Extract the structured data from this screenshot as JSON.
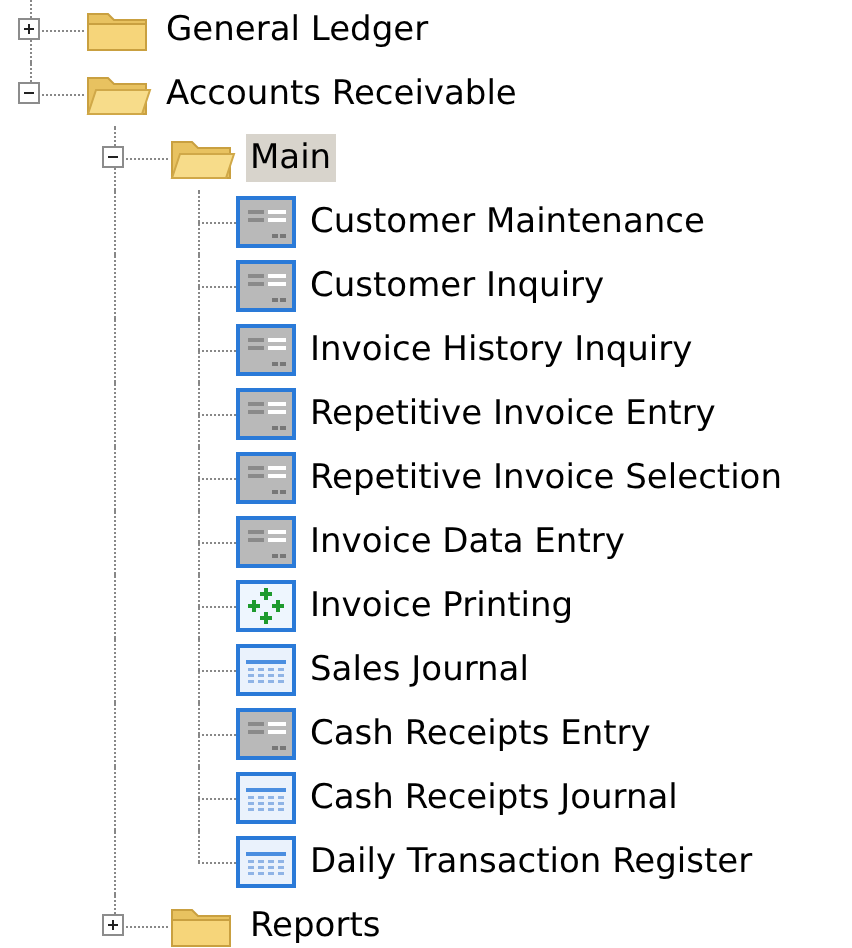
{
  "tree": [
    {
      "label": "General Ledger",
      "kind": "folder",
      "expanded": false,
      "selected": false
    },
    {
      "label": "Accounts Receivable",
      "kind": "folder",
      "expanded": true,
      "selected": false,
      "children": [
        {
          "label": "Main",
          "kind": "folder",
          "expanded": true,
          "selected": true,
          "children": [
            {
              "label": "Customer Maintenance",
              "kind": "form",
              "selected": false
            },
            {
              "label": "Customer Inquiry",
              "kind": "form",
              "selected": false
            },
            {
              "label": "Invoice History Inquiry",
              "kind": "form",
              "selected": false
            },
            {
              "label": "Repetitive Invoice Entry",
              "kind": "form",
              "selected": false
            },
            {
              "label": "Repetitive Invoice Selection",
              "kind": "form",
              "selected": false
            },
            {
              "label": "Invoice Data Entry",
              "kind": "form",
              "selected": false
            },
            {
              "label": "Invoice Printing",
              "kind": "process",
              "selected": false
            },
            {
              "label": "Sales Journal",
              "kind": "report",
              "selected": false
            },
            {
              "label": "Cash Receipts Entry",
              "kind": "form",
              "selected": false
            },
            {
              "label": "Cash Receipts Journal",
              "kind": "report",
              "selected": false
            },
            {
              "label": "Daily Transaction Register",
              "kind": "report",
              "selected": false
            }
          ]
        },
        {
          "label": "Reports",
          "kind": "folder",
          "expanded": false,
          "selected": false
        }
      ]
    }
  ]
}
